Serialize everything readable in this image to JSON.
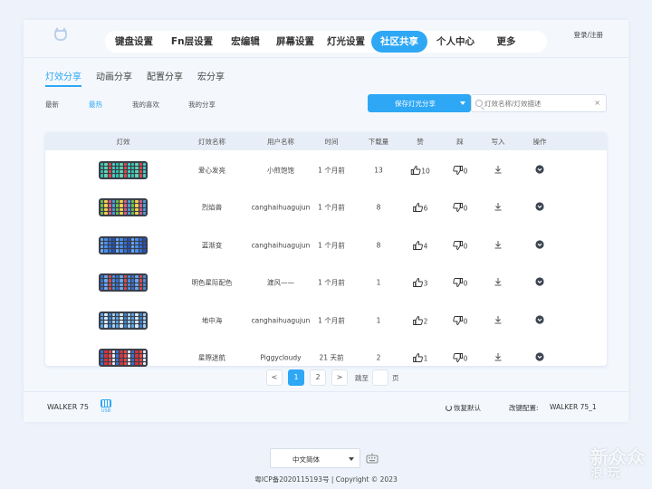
{
  "header": {
    "login_label": "登录/注册",
    "nav": [
      {
        "label": "键盘设置",
        "active": false
      },
      {
        "label": "Fn层设置",
        "active": false
      },
      {
        "label": "宏编辑",
        "active": false
      },
      {
        "label": "屏幕设置",
        "active": false
      },
      {
        "label": "灯光设置",
        "active": false
      },
      {
        "label": "社区共享",
        "active": true
      },
      {
        "label": "个人中心",
        "active": false
      },
      {
        "label": "更多",
        "active": false
      }
    ]
  },
  "subtabs": [
    "灯效分享",
    "动画分享",
    "配置分享",
    "宏分享"
  ],
  "filters": [
    "最新",
    "最热",
    "我的喜欢",
    "我的分享"
  ],
  "share_button": "保存灯光分享",
  "search": {
    "placeholder": "灯效名称/灯效描述",
    "clear": "×"
  },
  "table": {
    "headers": [
      "灯效",
      "灯效名称",
      "用户名称",
      "时间",
      "下载量",
      "赞",
      "踩",
      "写入",
      "操作"
    ],
    "rows": [
      {
        "name": "爱心发亮",
        "user": "小煎饱饱",
        "time": "1 个月前",
        "downloads": "13",
        "likes": "10",
        "dislikes": "0",
        "palette": [
          "#35c3a9",
          "#42d0c6",
          "#e0484a",
          "#5bd6b4"
        ]
      },
      {
        "name": "烈焰兽",
        "user": "canghaihuagujun",
        "time": "1 个月前",
        "downloads": "8",
        "likes": "6",
        "dislikes": "0",
        "palette": [
          "#f2d04a",
          "#6cc24a",
          "#4aa0e0",
          "#e05a8a"
        ]
      },
      {
        "name": "蓝渐变",
        "user": "canghaihuagujun",
        "time": "1 个月前",
        "downloads": "8",
        "likes": "4",
        "dislikes": "0",
        "palette": [
          "#2f6fd6",
          "#4a8ff0",
          "#6aaaf5",
          "#2554b8"
        ]
      },
      {
        "name": "明色星际配色",
        "user": "渡风——",
        "time": "1 个月前",
        "downloads": "1",
        "likes": "3",
        "dislikes": "0",
        "palette": [
          "#4a8fe0",
          "#d94b4b",
          "#6aa8f0",
          "#3a70c8"
        ]
      },
      {
        "name": "地中海",
        "user": "canghaihuagujun",
        "time": "1 个月前",
        "downloads": "1",
        "likes": "2",
        "dislikes": "0",
        "palette": [
          "#5da8e8",
          "#a6d2f5",
          "#3b86d6",
          "#d6ecfa"
        ]
      },
      {
        "name": "星際迷航",
        "user": "Piggycloudy",
        "time": "21 天前",
        "downloads": "2",
        "likes": "1",
        "dislikes": "0",
        "palette": [
          "#d6333c",
          "#3a6fd8",
          "#e8eef8",
          "#f04848"
        ]
      }
    ]
  },
  "pagination": {
    "prev": "<",
    "pages": [
      "1",
      "2"
    ],
    "current": "1",
    "next": ">",
    "jump_label": "跳至",
    "page_suffix": "页"
  },
  "statusbar": {
    "device": "WALKER 75",
    "usb": "USB",
    "reset": "恢复默认",
    "config_label": "改键配置:",
    "config_value": "WALKER 75_1"
  },
  "footer": {
    "language": "中文简体",
    "copyright": "粤ICP备2020115193号 | Copyright © 2023"
  },
  "watermark": {
    "line1": "新",
    "line2": "众",
    "line3": "浪",
    "line4": "玩"
  },
  "colors": {
    "accent": "#2ea7f5",
    "background": "#eef3fb",
    "panel": "#f4f8fd"
  }
}
